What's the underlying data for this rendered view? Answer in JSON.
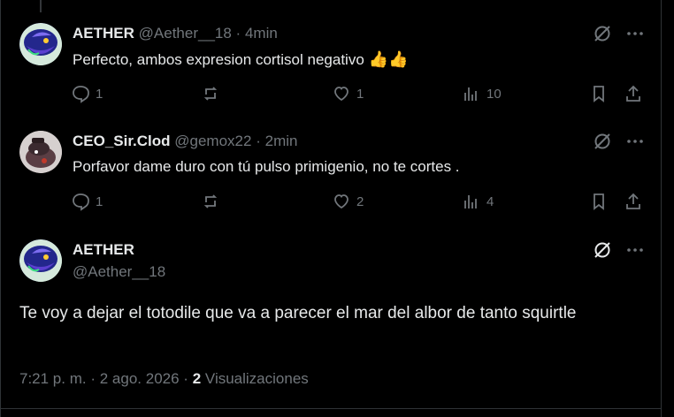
{
  "replies": [
    {
      "name": "AETHER",
      "handle": "@Aether__18",
      "sep": "·",
      "time": "4min",
      "text": "Perfecto, ambos expresion cortisol negativo",
      "emoji": "👍👍",
      "stats": {
        "replies": "1",
        "reposts": "",
        "likes": "1",
        "views": "10"
      },
      "avatar": "kyogre-avatar"
    },
    {
      "name": "CEO_Sir.Clod",
      "handle": "@gemox22",
      "sep": "·",
      "time": "2min",
      "text": "Porfavor dame duro con tú pulso primigenio, no te cortes .",
      "emoji": "",
      "stats": {
        "replies": "1",
        "reposts": "",
        "likes": "2",
        "views": "4"
      },
      "avatar": "ceo-avatar"
    }
  ],
  "main": {
    "name": "AETHER",
    "handle": "@Aether__18",
    "text": "Te voy a dejar el totodile que va a parecer el mar del albor de tanto squirtle",
    "time": "7:21 p. m.",
    "dot1": "·",
    "date": "2 ago. 2026",
    "dot2": "·",
    "views_count": "2",
    "views_label": "Visualizaciones"
  },
  "colors": {
    "background": "#000000",
    "text": "#e7e9ea",
    "muted": "#71767b",
    "border": "#2f3336"
  }
}
